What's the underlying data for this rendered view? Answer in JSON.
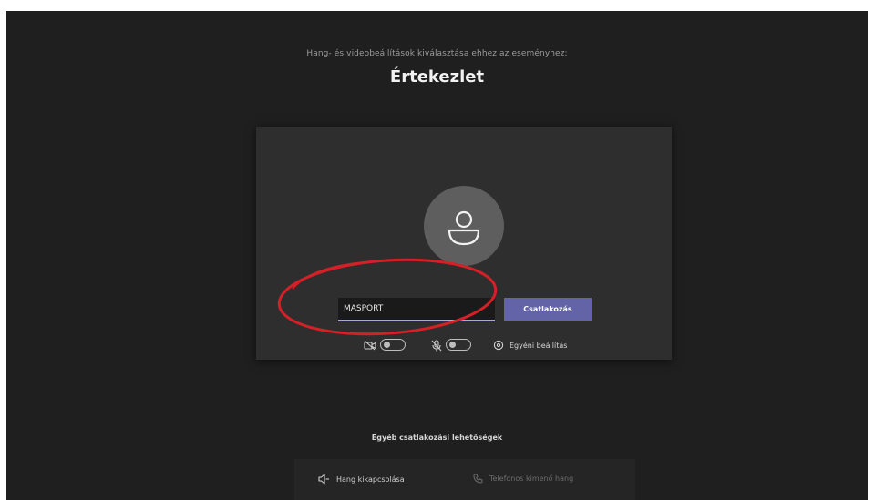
{
  "header": {
    "subtitle": "Hang- és videobeállítások kiválasztása ehhez az eseményhez:",
    "title": "Értekezlet"
  },
  "prejoin": {
    "avatar_icon": "person-icon",
    "name_input": {
      "value": "MASPORT",
      "placeholder": ""
    },
    "join_label": "Csatlakozás",
    "camera_icon": "camera-off-icon",
    "camera_on": false,
    "mic_icon": "microphone-off-icon",
    "mic_on": false,
    "device_settings_icon": "gear-icon",
    "device_settings_label": "Egyéni beállítás"
  },
  "other_options": {
    "heading": "Egyéb csatlakozási lehetőségek",
    "audio_off_label": "Hang kikapcsolása",
    "audio_off_icon": "speaker-off-icon",
    "phone_audio_label": "Telefonos kimenő hang",
    "phone_audio_icon": "phone-icon"
  },
  "colors": {
    "background": "#201f1f",
    "card": "#2f2e2e",
    "accent": "#6264a7",
    "annotation": "#d42027"
  },
  "annotation": {
    "shape": "ellipse",
    "color": "#d42027"
  }
}
